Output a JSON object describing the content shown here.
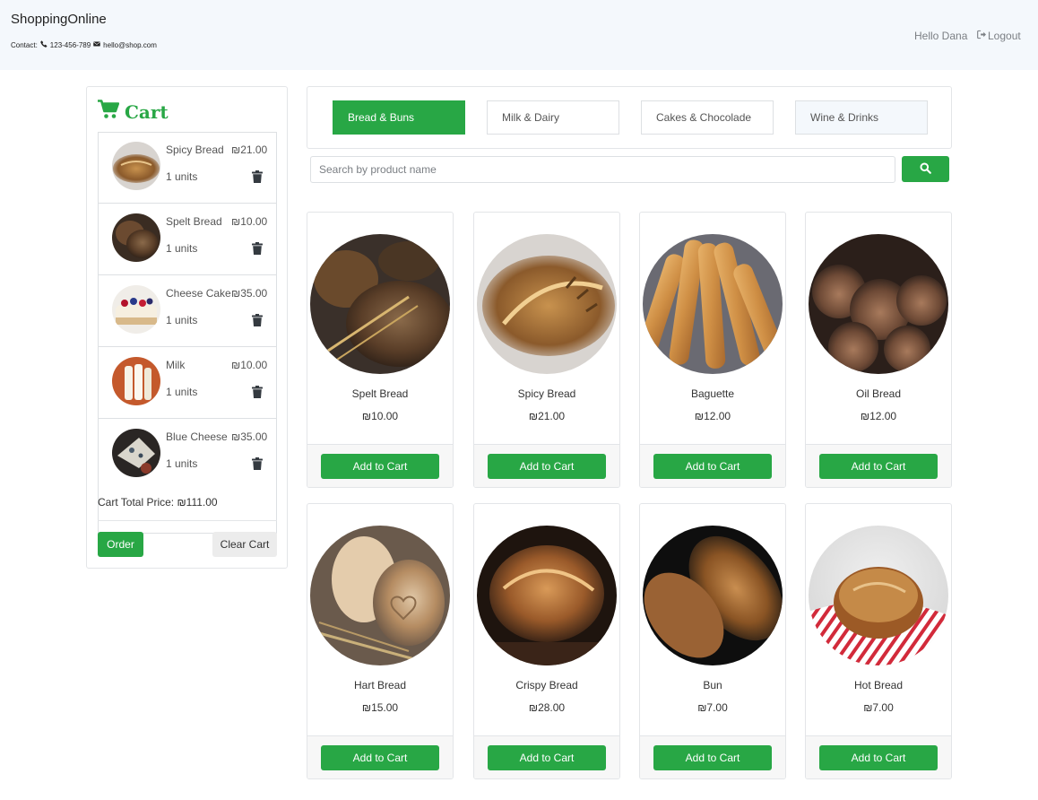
{
  "header": {
    "brand": "ShoppingOnline",
    "contact_label": "Contact:",
    "phone": "123-456-789",
    "email": "hello@shop.com",
    "greeting": "Hello Dana",
    "logout_label": "Logout"
  },
  "cart": {
    "title": "Cart",
    "items": [
      {
        "name": "Spicy Bread",
        "price": "₪21.00",
        "units": "1 units",
        "thumb": "bread-photo"
      },
      {
        "name": "Spelt Bread",
        "price": "₪10.00",
        "units": "1 units",
        "thumb": "bread-photo"
      },
      {
        "name": "Cheese Cake",
        "price": "₪35.00",
        "units": "1 units",
        "thumb": "cake-photo"
      },
      {
        "name": "Milk",
        "price": "₪10.00",
        "units": "1 units",
        "thumb": "milk-photo"
      },
      {
        "name": "Blue Cheese",
        "price": "₪35.00",
        "units": "1 units",
        "thumb": "cheese-photo"
      }
    ],
    "total_text": "Cart Total Price: ₪111.00",
    "order_label": "Order",
    "clear_label": "Clear Cart"
  },
  "categories": {
    "items": [
      "Bread & Buns",
      "Milk & Dairy",
      "Cakes & Chocolade",
      "Wine & Drinks"
    ],
    "active": "Bread & Buns"
  },
  "search": {
    "placeholder": "Search by product name",
    "value": ""
  },
  "products": [
    {
      "name": "Spelt Bread",
      "price": "₪10.00",
      "add_label": "Add to Cart"
    },
    {
      "name": "Spicy Bread",
      "price": "₪21.00",
      "add_label": "Add to Cart"
    },
    {
      "name": "Baguette",
      "price": "₪12.00",
      "add_label": "Add to Cart"
    },
    {
      "name": "Oil Bread",
      "price": "₪12.00",
      "add_label": "Add to Cart"
    },
    {
      "name": "Hart Bread",
      "price": "₪15.00",
      "add_label": "Add to Cart"
    },
    {
      "name": "Crispy Bread",
      "price": "₪28.00",
      "add_label": "Add to Cart"
    },
    {
      "name": "Bun",
      "price": "₪7.00",
      "add_label": "Add to Cart"
    },
    {
      "name": "Hot Bread",
      "price": "₪7.00",
      "add_label": "Add to Cart"
    }
  ],
  "colors": {
    "accent": "#28a745",
    "navbar_bg": "#f4f8fc",
    "border": "#e3e5e8"
  },
  "icons": {
    "phone": "phone-icon",
    "email": "envelope-icon",
    "logout": "logout-icon",
    "cart": "shopping-cart-icon",
    "trash": "trash-icon",
    "search": "search-icon"
  }
}
